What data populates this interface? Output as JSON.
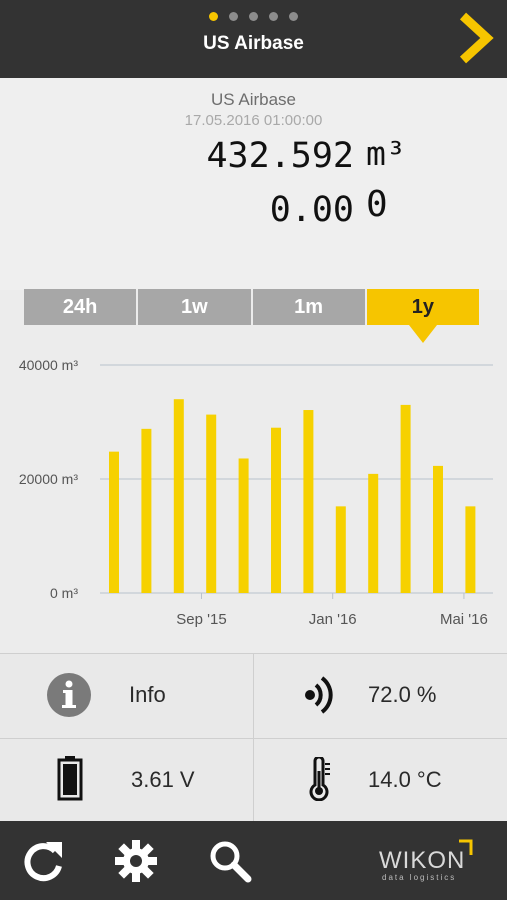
{
  "header": {
    "title": "US Airbase",
    "page_count": 5,
    "active_page": 1,
    "next_icon": "chevron-right-icon",
    "accent_color": "#f6c500"
  },
  "reading": {
    "device_name": "US Airbase",
    "timestamp": "17.05.2016 01:00:00",
    "volume_value": "432.592",
    "volume_unit": "m³",
    "flow_value": "0.00",
    "flow_unit": "0"
  },
  "tabs": [
    {
      "label": "24h",
      "active": false
    },
    {
      "label": "1w",
      "active": false
    },
    {
      "label": "1m",
      "active": false
    },
    {
      "label": "1y",
      "active": true
    }
  ],
  "chart_data": {
    "type": "bar",
    "series": [
      {
        "values": [
          24800,
          28800,
          34000,
          31300,
          23600,
          29000,
          32100,
          15200,
          20900,
          33000,
          22300,
          15200
        ]
      }
    ],
    "x_tick_labels": [
      {
        "label": "Sep '15",
        "index": 2.7
      },
      {
        "label": "Jan '16",
        "index": 6.75
      },
      {
        "label": "Mai '16",
        "index": 10.8
      }
    ],
    "y_ticks": [
      {
        "value": 0,
        "label": "0 m³"
      },
      {
        "value": 20000,
        "label": "20000 m³"
      },
      {
        "value": 40000,
        "label": "40000 m³"
      }
    ],
    "ylim": [
      0,
      40000
    ],
    "bar_color": "#f6d100",
    "grid": true
  },
  "stats": {
    "info_label": "Info",
    "signal_value": "72.0 %",
    "battery_value": "3.61 V",
    "temperature_value": "14.0 °C",
    "info_icon": "info-icon",
    "signal_icon": "signal-icon",
    "battery_icon": "battery-icon",
    "temperature_icon": "thermometer-icon"
  },
  "footer": {
    "refresh_icon": "refresh-icon",
    "settings_icon": "gear-icon",
    "search_icon": "search-icon",
    "logo_text": "WIKON",
    "logo_subtext": "data logistics"
  }
}
